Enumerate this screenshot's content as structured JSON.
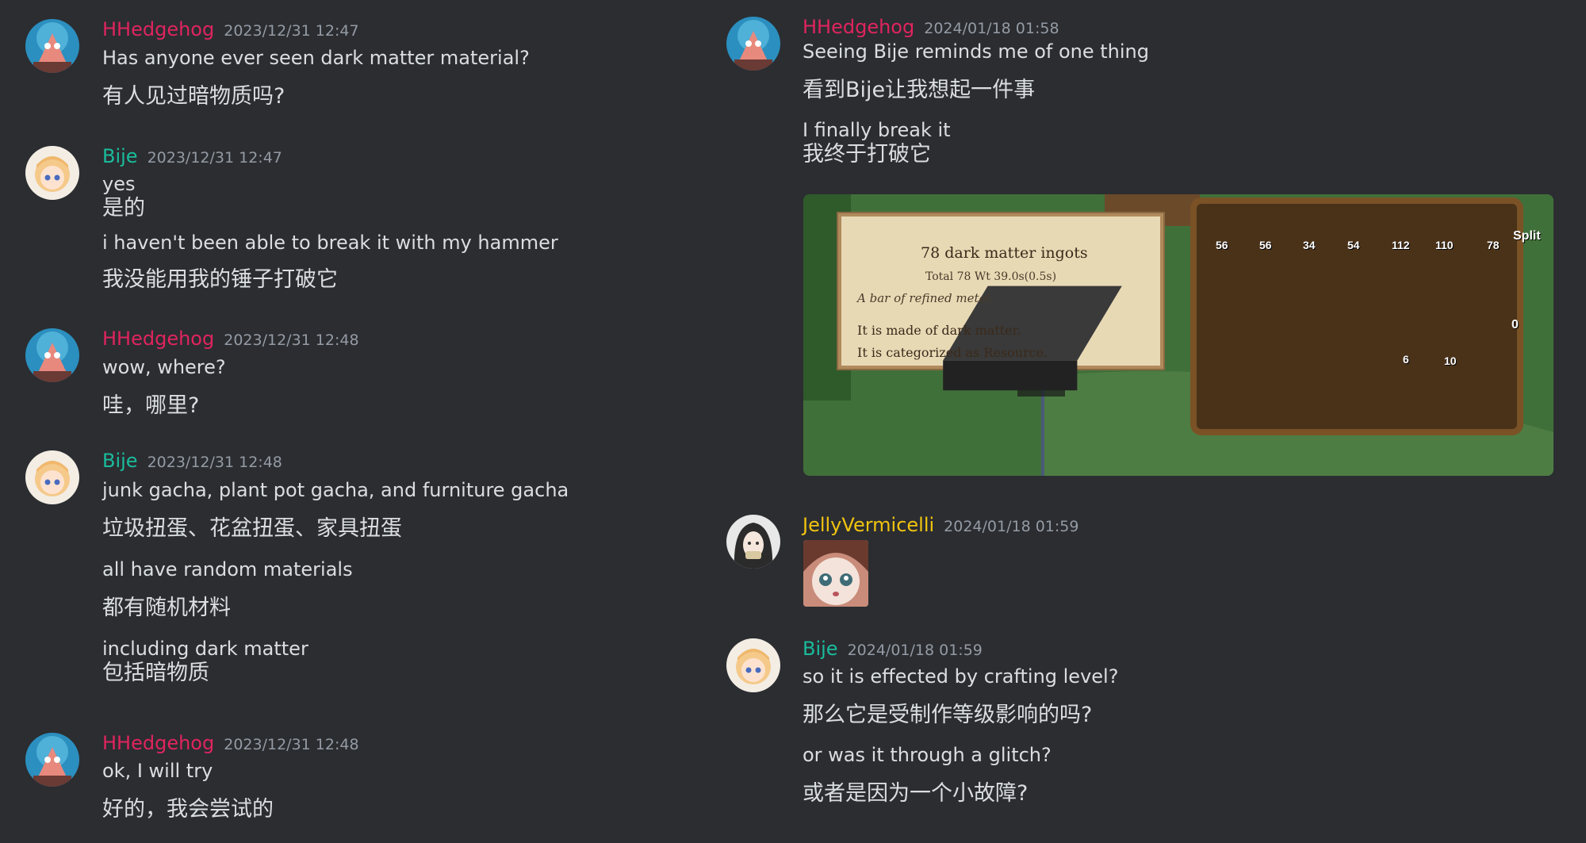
{
  "colors": {
    "background": "#2b2d31",
    "hhedgehog": "#e0245e",
    "bije": "#1abc9c",
    "jellyvermicelli": "#f1c40f",
    "timestamp": "#949ba4",
    "text": "#dbdee1"
  },
  "left_column": {
    "messages": [
      {
        "author": "HHedgehog",
        "timestamp": "2023/12/31 12:47",
        "lines": [
          "Has anyone ever seen dark matter material?",
          "有人见过暗物质吗?"
        ]
      },
      {
        "author": "Bije",
        "timestamp": "2023/12/31 12:47",
        "lines": [
          "yes",
          "是的",
          "i haven't been able to break it with my hammer",
          "我没能用我的锤子打破它"
        ]
      },
      {
        "author": "HHedgehog",
        "timestamp": "2023/12/31 12:48",
        "lines": [
          "wow, where?",
          "哇，哪里?"
        ]
      },
      {
        "author": "Bije",
        "timestamp": "2023/12/31 12:48",
        "lines": [
          "junk gacha, plant pot gacha, and furniture gacha",
          "垃圾扭蛋、花盆扭蛋、家具扭蛋",
          "all have random materials",
          "都有随机材料",
          "including dark matter",
          "包括暗物质"
        ]
      },
      {
        "author": "HHedgehog",
        "timestamp": "2023/12/31 12:48",
        "lines": [
          "ok, I will try",
          "好的，我会尝试的"
        ]
      }
    ]
  },
  "right_column": {
    "messages": [
      {
        "author": "HHedgehog",
        "timestamp": "2024/01/18 01:58",
        "lines": [
          "Seeing Bije reminds me of one thing",
          "看到Bije让我想起一件事",
          "I finally break it",
          "我终于打破它"
        ]
      },
      {
        "author": "JellyVermicelli",
        "timestamp": "2024/01/18 01:59",
        "lines": []
      },
      {
        "author": "Bije",
        "timestamp": "2024/01/18 01:59",
        "lines": [
          "so it is effected by crafting level?",
          "那么它是受制作等级影响的吗?",
          "or was it through a glitch?",
          "或者是因为一个小故障?"
        ]
      }
    ]
  },
  "attachment": {
    "tooltip": {
      "title": "78 dark matter ingots",
      "subtitle": "Total 78  Wt 39.0s(0.5s)",
      "description": "A bar of refined metal.",
      "line1": "It is made of dark matter.",
      "line2": "It is categorized as Resource."
    },
    "inventory_counts": [
      "56",
      "56",
      "34",
      "54",
      "112",
      "110",
      "78",
      "6",
      "10"
    ],
    "split_label": "Split",
    "side_digit": "0"
  }
}
